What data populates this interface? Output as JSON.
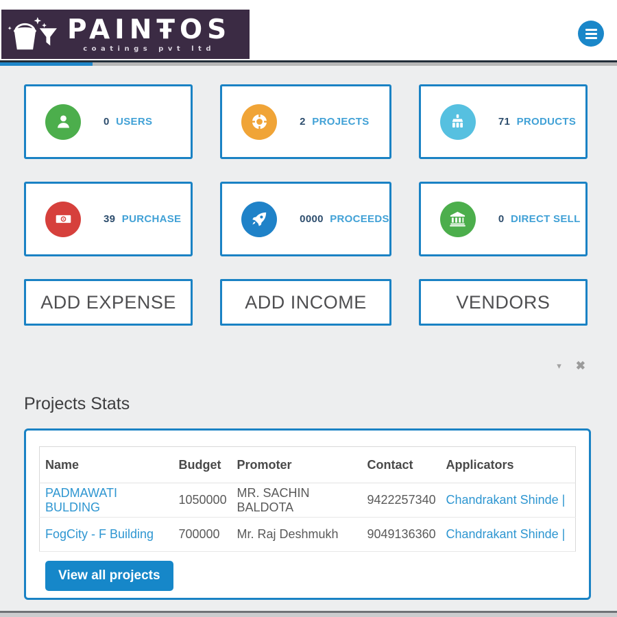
{
  "brand": {
    "title": "PAINŦOS",
    "subtitle": "coatings pvt ltd",
    "bg_color": "#3b2b44"
  },
  "header": {
    "menu_icon": "hamburger-icon",
    "accent_color": "#1a87c9"
  },
  "progress": {
    "value_color": "#1e86c9",
    "track_color": "#b7b7b7"
  },
  "stats": [
    {
      "count": "0",
      "label": "USERS",
      "icon": "user-icon",
      "color": "#4cae4c"
    },
    {
      "count": "2",
      "label": "PROJECTS",
      "icon": "life-ring-icon",
      "color": "#f0a437"
    },
    {
      "count": "71",
      "label": "PRODUCTS",
      "icon": "paint-brush-icon",
      "color": "#56c0e0"
    },
    {
      "count": "39",
      "label": "PURCHASE",
      "icon": "money-icon",
      "color": "#d6403c"
    },
    {
      "count": "0000",
      "label": "PROCEEDS",
      "icon": "rocket-icon",
      "color": "#1f82c8"
    },
    {
      "count": "0",
      "label": "DIRECT SELL",
      "icon": "bank-icon",
      "color": "#4cae4c"
    }
  ],
  "actions": [
    "ADD EXPENSE",
    "ADD INCOME",
    "VENDORS"
  ],
  "panel_controls": {
    "collapse_icon": "▾",
    "close_icon": "✖"
  },
  "projects": {
    "title": "Projects Stats",
    "columns": [
      "Name",
      "Budget",
      "Promoter",
      "Contact",
      "Applicators"
    ],
    "rows": [
      {
        "name": "PADMAWATI BULDING",
        "budget": "1050000",
        "promoter": "MR. SACHIN BALDOTA",
        "contact": "9422257340",
        "applicators": "Chandrakant Shinde |"
      },
      {
        "name": "FogCity - F Building",
        "budget": "700000",
        "promoter": "Mr. Raj Deshmukh",
        "contact": "9049136360",
        "applicators": "Chandrakant Shinde |"
      }
    ],
    "view_all_label": "View all projects"
  },
  "colors": {
    "accent": "#1a82c4",
    "link": "#2e96d1",
    "count_text": "#2d4d6d",
    "label_text": "#41a1d6",
    "page_bg": "#edeeef"
  }
}
